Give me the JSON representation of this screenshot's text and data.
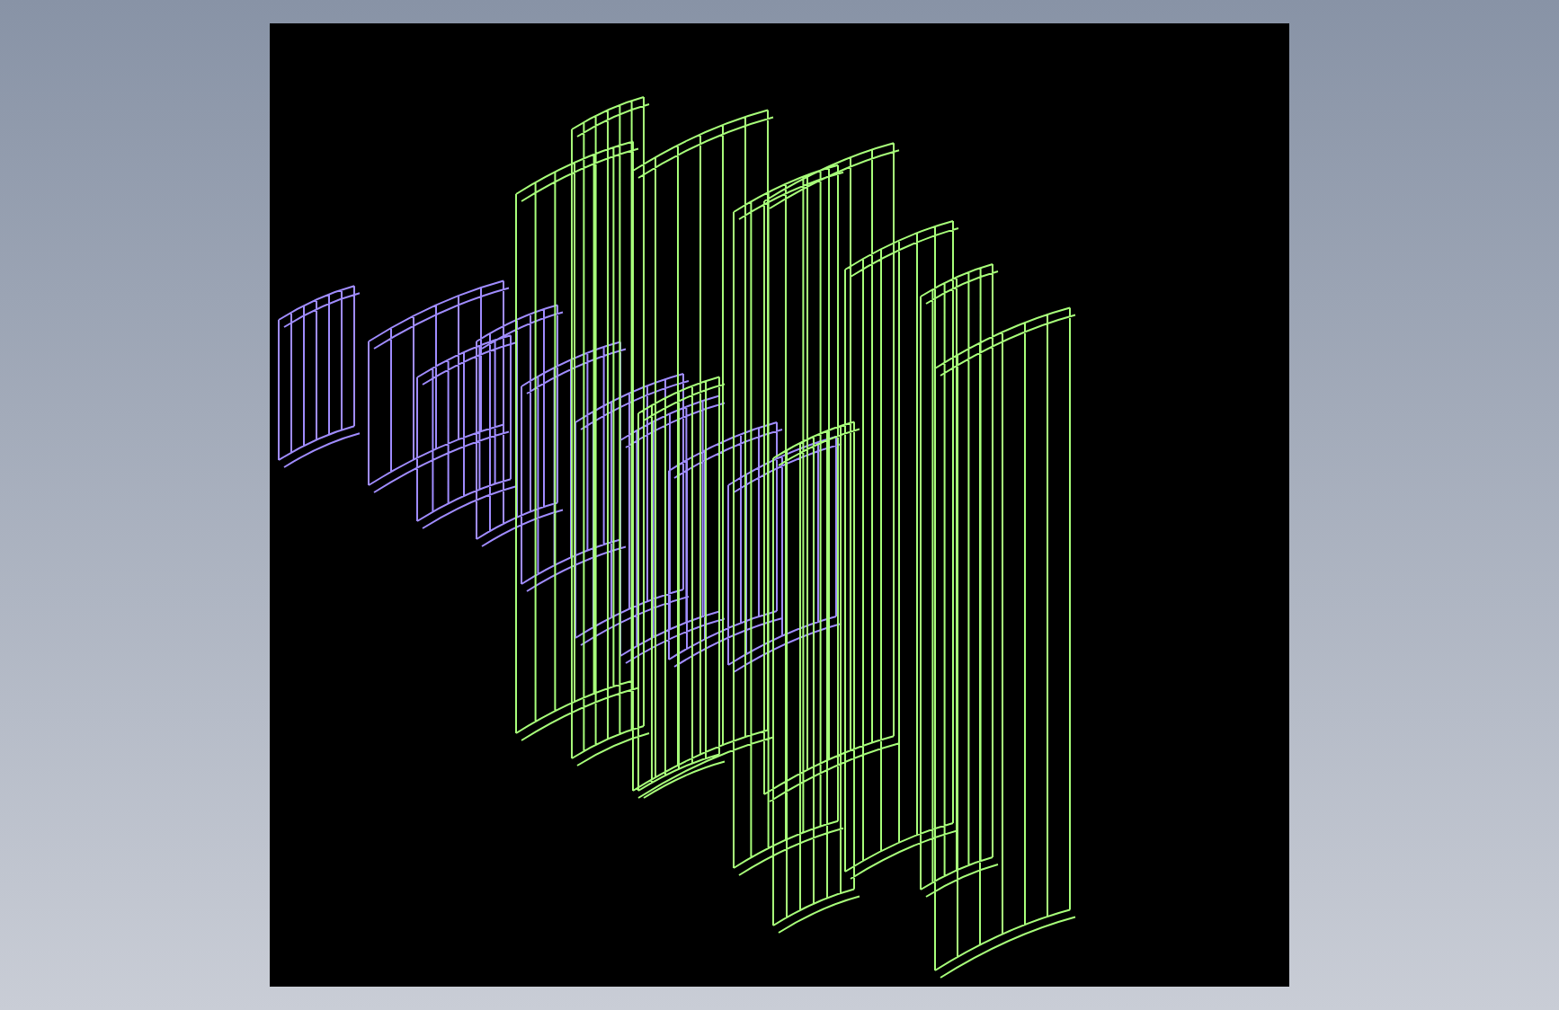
{
  "viewport": {
    "wireframes": [
      {
        "color": "#a08cff"
      },
      {
        "color": "#a8ff7a"
      }
    ]
  }
}
